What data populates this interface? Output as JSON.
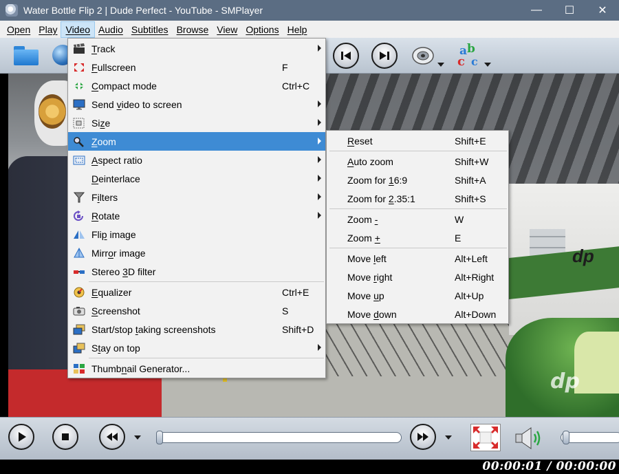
{
  "window": {
    "title": "Water Bottle Flip 2 | Dude Perfect - YouTube - SMPlayer",
    "minimize": "—",
    "maximize": "☐",
    "close": "✕"
  },
  "menubar": {
    "items": [
      {
        "label": "Open"
      },
      {
        "label": "Play"
      },
      {
        "label": "Video",
        "active": true
      },
      {
        "label": "Audio"
      },
      {
        "label": "Subtitles"
      },
      {
        "label": "Browse"
      },
      {
        "label": "View"
      },
      {
        "label": "Options"
      },
      {
        "label": "Help"
      }
    ]
  },
  "video_menu": {
    "items": [
      {
        "icon": "clapperboard-icon",
        "label_u": "T",
        "label_rest": "rack",
        "shortcut": "",
        "submenu": true
      },
      {
        "icon": "fullscreen-icon",
        "label_u": "F",
        "label_rest": "ullscreen",
        "shortcut": "F",
        "submenu": false
      },
      {
        "icon": "compact-mode-icon",
        "label_u": "C",
        "label_rest": "ompact mode",
        "shortcut": "Ctrl+C",
        "submenu": false
      },
      {
        "icon": "monitor-icon",
        "label_pre": "Send ",
        "label_u": "v",
        "label_rest": "ideo to screen",
        "shortcut": "",
        "submenu": true
      },
      {
        "icon": "size-icon",
        "label_pre": "Si",
        "label_u": "z",
        "label_rest": "e",
        "shortcut": "",
        "submenu": true
      },
      {
        "icon": "zoom-icon",
        "label_u": "Z",
        "label_rest": "oom",
        "shortcut": "",
        "submenu": true,
        "highlighted": true
      },
      {
        "icon": "aspect-ratio-icon",
        "label_u": "A",
        "label_rest": "spect ratio",
        "shortcut": "",
        "submenu": true
      },
      {
        "icon": "",
        "label_u": "D",
        "label_rest": "einterlace",
        "shortcut": "",
        "submenu": true
      },
      {
        "icon": "filter-icon",
        "label_pre": "F",
        "label_u": "i",
        "label_rest": "lters",
        "shortcut": "",
        "submenu": true
      },
      {
        "icon": "rotate-icon",
        "label_u": "R",
        "label_rest": "otate",
        "shortcut": "",
        "submenu": true
      },
      {
        "icon": "flip-icon",
        "label_pre": "Fli",
        "label_u": "p",
        "label_rest": " image",
        "shortcut": "",
        "submenu": false
      },
      {
        "icon": "mirror-icon",
        "label_pre": "Mirr",
        "label_u": "o",
        "label_rest": "r image",
        "shortcut": "",
        "submenu": false
      },
      {
        "icon": "stereo-3d-icon",
        "label_pre": "Stereo ",
        "label_u": "3",
        "label_rest": "D filter",
        "shortcut": "",
        "submenu": false
      },
      {
        "separator": true
      },
      {
        "icon": "equalizer-icon",
        "label_u": "E",
        "label_rest": "qualizer",
        "shortcut": "Ctrl+E",
        "submenu": false
      },
      {
        "icon": "screenshot-icon",
        "label_u": "S",
        "label_rest": "creenshot",
        "shortcut": "S",
        "submenu": false
      },
      {
        "icon": "screenshots-icon",
        "label_pre": "Start/stop ",
        "label_u": "t",
        "label_rest": "aking screenshots",
        "shortcut": "Shift+D",
        "submenu": false
      },
      {
        "icon": "stay-on-top-icon",
        "label_pre": "S",
        "label_u": "t",
        "label_rest": "ay on top",
        "shortcut": "",
        "submenu": true
      },
      {
        "separator": true
      },
      {
        "icon": "thumbnail-icon",
        "label_pre": "Thumb",
        "label_u": "n",
        "label_rest": "ail Generator...",
        "shortcut": "",
        "submenu": false
      }
    ]
  },
  "zoom_menu": {
    "items": [
      {
        "label_u": "R",
        "label_rest": "eset",
        "shortcut": "Shift+E"
      },
      {
        "separator": true
      },
      {
        "label_u": "A",
        "label_rest": "uto zoom",
        "shortcut": "Shift+W"
      },
      {
        "label_pre": "Zoom for ",
        "label_u": "1",
        "label_rest": "6:9",
        "shortcut": "Shift+A"
      },
      {
        "label_pre": "Zoom for ",
        "label_u": "2",
        "label_rest": ".35:1",
        "shortcut": "Shift+S"
      },
      {
        "separator": true
      },
      {
        "label_pre": "Zoom ",
        "label_u": "-",
        "label_rest": "",
        "shortcut": "W"
      },
      {
        "label_pre": "Zoom ",
        "label_u": "+",
        "label_rest": "",
        "shortcut": "E"
      },
      {
        "separator": true
      },
      {
        "label_pre": "Move ",
        "label_u": "l",
        "label_rest": "eft",
        "shortcut": "Alt+Left"
      },
      {
        "label_pre": "Move ",
        "label_u": "r",
        "label_rest": "ight",
        "shortcut": "Alt+Right"
      },
      {
        "label_pre": "Move ",
        "label_u": "u",
        "label_rest": "p",
        "shortcut": "Alt+Up"
      },
      {
        "label_pre": "Move ",
        "label_u": "d",
        "label_rest": "own",
        "shortcut": "Alt+Down"
      }
    ]
  },
  "video": {
    "watermark": "dp"
  },
  "status": {
    "time": "00:00:01 / 00:00:00"
  },
  "colors": {
    "titlebar": "#5b6d83",
    "menu_highlight": "#3e8bd4",
    "menubar_active": "#cce4f7"
  }
}
